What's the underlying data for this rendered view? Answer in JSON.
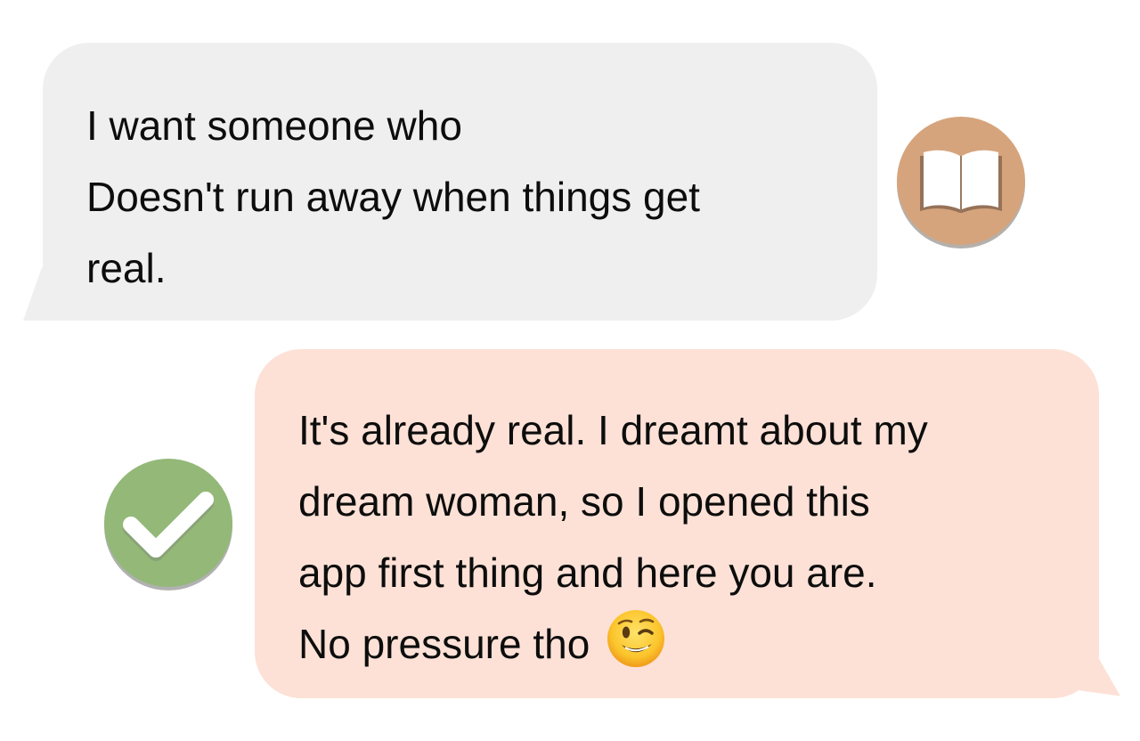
{
  "conversation": {
    "incoming": {
      "avatar_icon": "open-book-icon",
      "avatar_color": "#d6a47c",
      "bubble_color": "#efefef",
      "lines": [
        "I want someone who",
        "Doesn't run away when things get",
        "real."
      ]
    },
    "outgoing": {
      "avatar_icon": "checkmark-icon",
      "avatar_color": "#93b878",
      "bubble_color": "#fde1d6",
      "lines": [
        "It's already real. I dreamt about my",
        "dream woman, so I opened this",
        "app first thing and here you are.",
        "No pressure tho"
      ],
      "trailing_emoji": "winking-face-emoji"
    }
  }
}
